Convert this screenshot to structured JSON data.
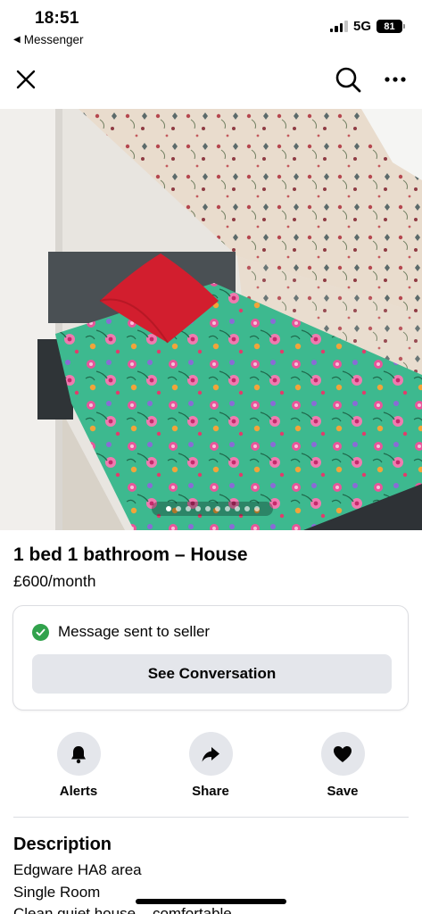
{
  "status_bar": {
    "time": "18:51",
    "back_app": "Messenger",
    "network": "5G",
    "battery": "81"
  },
  "nav": {
    "close_icon": "close-icon",
    "search_icon": "search-icon",
    "more_icon": "more-options-icon"
  },
  "photo": {
    "image_count": 10,
    "active_index": 0
  },
  "listing": {
    "title": "1 bed 1 bathroom – House",
    "price": "£600/month"
  },
  "message_card": {
    "status_text": "Message sent to seller",
    "button_label": "See Conversation"
  },
  "actions": [
    {
      "label": "Alerts",
      "icon": "bell-icon"
    },
    {
      "label": "Share",
      "icon": "share-arrow-icon"
    },
    {
      "label": "Save",
      "icon": "heart-icon"
    }
  ],
  "description": {
    "heading": "Description",
    "lines": [
      "Edgware HA8 area",
      "Single Room",
      "Clean quiet house – comfortable"
    ]
  },
  "colors": {
    "success_green": "#31a24c",
    "button_grey": "#e4e6eb",
    "duvet_green": "#3fb68e",
    "pillow_red": "#d21e2e"
  }
}
